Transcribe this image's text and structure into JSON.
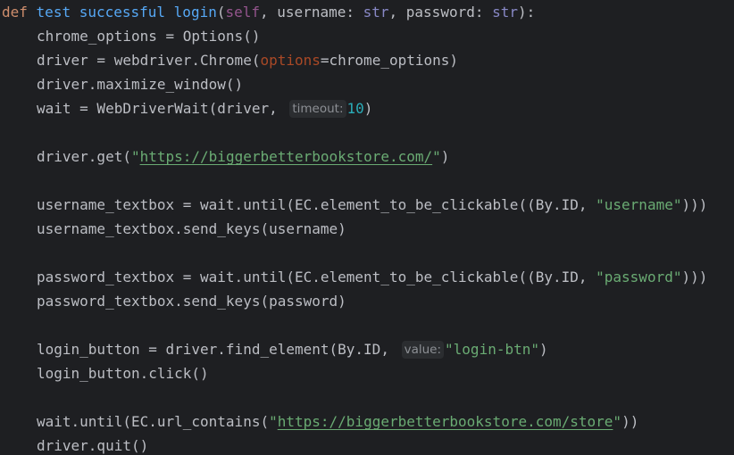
{
  "code": {
    "l1": {
      "def_kw": "def",
      "fn_name": "test successful login",
      "open": "(",
      "self_kw": "self",
      "rest1": ", username: ",
      "str1": "str",
      "rest2": ", password: ",
      "str2": "str",
      "close": "):"
    },
    "l2": {
      "text": "chrome_options = Options()"
    },
    "l3": {
      "a": "driver = webdriver.Chrome(",
      "param": "options",
      "b": "=chrome_options)"
    },
    "l4": {
      "text": "driver.maximize_window()"
    },
    "l5": {
      "a": "wait = WebDriverWait(driver,",
      "hint": "timeout:",
      "num": "10",
      "b": ")"
    },
    "l7": {
      "a": "driver.get(",
      "q1": "\"",
      "url": "https://biggerbetterbookstore.com/",
      "q2": "\"",
      "b": ")"
    },
    "l9": {
      "a": "username_textbox = wait.until(EC.element_to_be_clickable((By.ID, ",
      "str": "\"username\"",
      "b": ")))"
    },
    "l10": {
      "text": "username_textbox.send_keys(username)"
    },
    "l12": {
      "a": "password_textbox = wait.until(EC.element_to_be_clickable((By.ID, ",
      "str": "\"password\"",
      "b": ")))"
    },
    "l13": {
      "text": "password_textbox.send_keys(password)"
    },
    "l15": {
      "a": "login_button = driver.find_element(By.ID,",
      "hint": "value:",
      "str": "\"login-btn\"",
      "b": ")"
    },
    "l16": {
      "text": "login_button.click()"
    },
    "l18": {
      "a": "wait.until(EC.url_contains(",
      "q1": "\"",
      "url": "https://biggerbetterbookstore.com/store",
      "q2": "\"",
      "b": "))"
    },
    "l19": {
      "text": "driver.quit()"
    }
  },
  "colors": {
    "background": "#1e1f22",
    "default_text": "#bcbec4",
    "keyword": "#cf8e6d",
    "function_name": "#56a8f5",
    "self": "#94558d",
    "builtin": "#8888c6",
    "named_param": "#aa4926",
    "string": "#6aab73",
    "number": "#2aacb8",
    "inlay_hint_bg": "#2b2d30",
    "inlay_hint_text": "#8c8f94"
  }
}
